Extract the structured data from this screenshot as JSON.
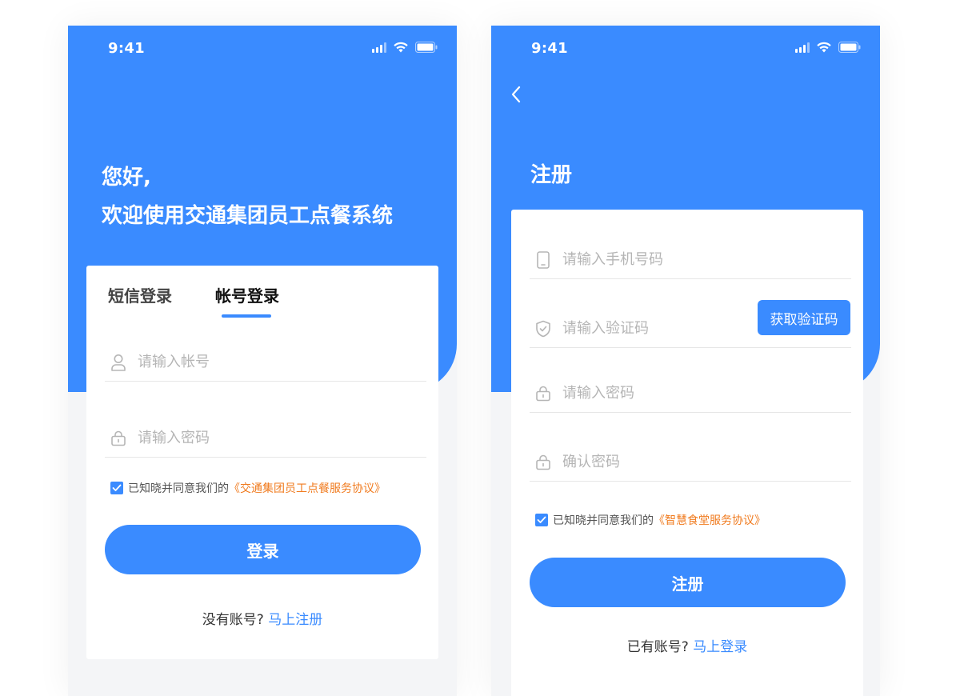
{
  "login_screen": {
    "status_time": "9:41",
    "greeting_line1": "您好,",
    "greeting_line2": "欢迎使用交通集团员工点餐系统",
    "tabs": [
      {
        "label": "短信登录",
        "active": false
      },
      {
        "label": "帐号登录",
        "active": true
      }
    ],
    "account_placeholder": "请输入帐号",
    "password_placeholder": "请输入密码",
    "agree_text": "已知晓并同意我们的",
    "agree_link": "《交通集团员工点餐服务协议》",
    "agree_checked": true,
    "submit_label": "登录",
    "footer_text": "没有账号?",
    "footer_link": "马上注册"
  },
  "register_screen": {
    "status_time": "9:41",
    "title": "注册",
    "phone_placeholder": "请输入手机号码",
    "code_placeholder": "请输入验证码",
    "get_code_label": "获取验证码",
    "password_placeholder": "请输入密码",
    "confirm_placeholder": "确认密码",
    "agree_text": "已知晓并同意我们的",
    "agree_link": "《智慧食堂服务协议》",
    "agree_checked": true,
    "submit_label": "注册",
    "footer_text": "已有账号?",
    "footer_link": "马上登录"
  },
  "colors": {
    "primary": "#3a8bff",
    "link_orange": "#f07b1f",
    "background": "#f4f5f7"
  },
  "icons": [
    "signal-icon",
    "wifi-icon",
    "battery-icon",
    "user-icon",
    "lock-icon",
    "phone-icon",
    "shield-icon",
    "back-arrow-icon",
    "check-icon"
  ]
}
